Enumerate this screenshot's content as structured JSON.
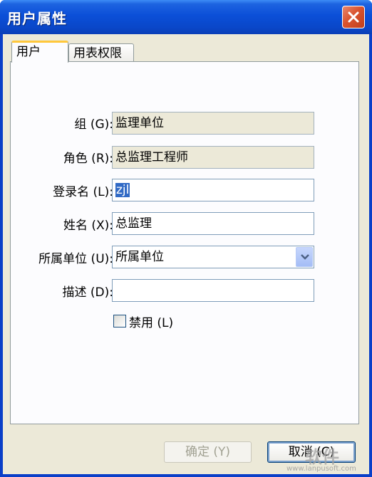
{
  "window": {
    "title": "用户属性",
    "close_icon": "close-icon"
  },
  "tabs": [
    {
      "label": "用户",
      "active": true
    },
    {
      "label": "用表权限",
      "active": false
    }
  ],
  "form": {
    "group": {
      "label": "组 (G):",
      "value": "监理单位"
    },
    "role": {
      "label": "角色 (R):",
      "value": "总监理工程师"
    },
    "login": {
      "label": "登录名 (L):",
      "value": "zjl"
    },
    "name": {
      "label": "姓名 (X):",
      "value": "总监理"
    },
    "unit": {
      "label": "所属单位 (U):",
      "value": "所属单位",
      "icon": "chevron-down-icon"
    },
    "desc": {
      "label": "描述 (D):",
      "value": ""
    },
    "disabled": {
      "label": "禁用 (L)",
      "checked": false
    }
  },
  "buttons": {
    "ok": "确定 (Y)",
    "cancel": "取消 (C)"
  },
  "watermark": {
    "text": "软件",
    "url": "www.lanpusoft.com"
  },
  "colors": {
    "titlebar": "#0a4fd8",
    "close_button": "#d9532f",
    "active_tab_accent": "#ffc83c",
    "selection": "#316ac5"
  }
}
